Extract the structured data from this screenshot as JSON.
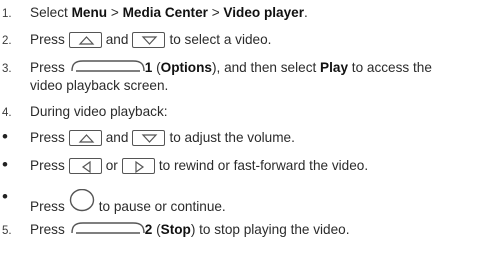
{
  "steps": {
    "s1": {
      "num": "1.",
      "t1": "Select ",
      "b1": "Menu",
      "t2": " > ",
      "b2": "Media Center",
      "t3": " > ",
      "b3": "Video player",
      "t4": "."
    },
    "s2": {
      "num": "2.",
      "t1": "Press",
      "t2": "and",
      "t3": "to select a video."
    },
    "s3": {
      "num": "3.",
      "t1": "Press",
      "key_num": "1",
      "t2": " (",
      "b1": "Options",
      "t3": "), and then select ",
      "b2": "Play",
      "t4": " to access the",
      "t5": "video playback screen."
    },
    "s4": {
      "num": "4.",
      "t1": "During video playback:"
    },
    "b1": {
      "bullet": "•",
      "t1": "Press",
      "t2": "and",
      "t3": "to adjust the volume."
    },
    "b2": {
      "bullet": "•",
      "t1": "Press",
      "t2": "or",
      "t3": "to rewind or fast-forward the video."
    },
    "b3": {
      "bullet": "•",
      "t1": "Press",
      "t2": "to pause or continue."
    },
    "s5": {
      "num": "5.",
      "t1": "Press",
      "key_num": "2",
      "t2": " (",
      "b1": "Stop",
      "t3": ") to stop playing the video."
    }
  },
  "icons": {
    "up_key": "up-arrow-key-icon",
    "down_key": "down-arrow-key-icon",
    "left_key": "left-arrow-key-icon",
    "right_key": "right-arrow-key-icon",
    "ok_key": "center-round-key-icon",
    "soft_key": "soft-key-icon"
  }
}
